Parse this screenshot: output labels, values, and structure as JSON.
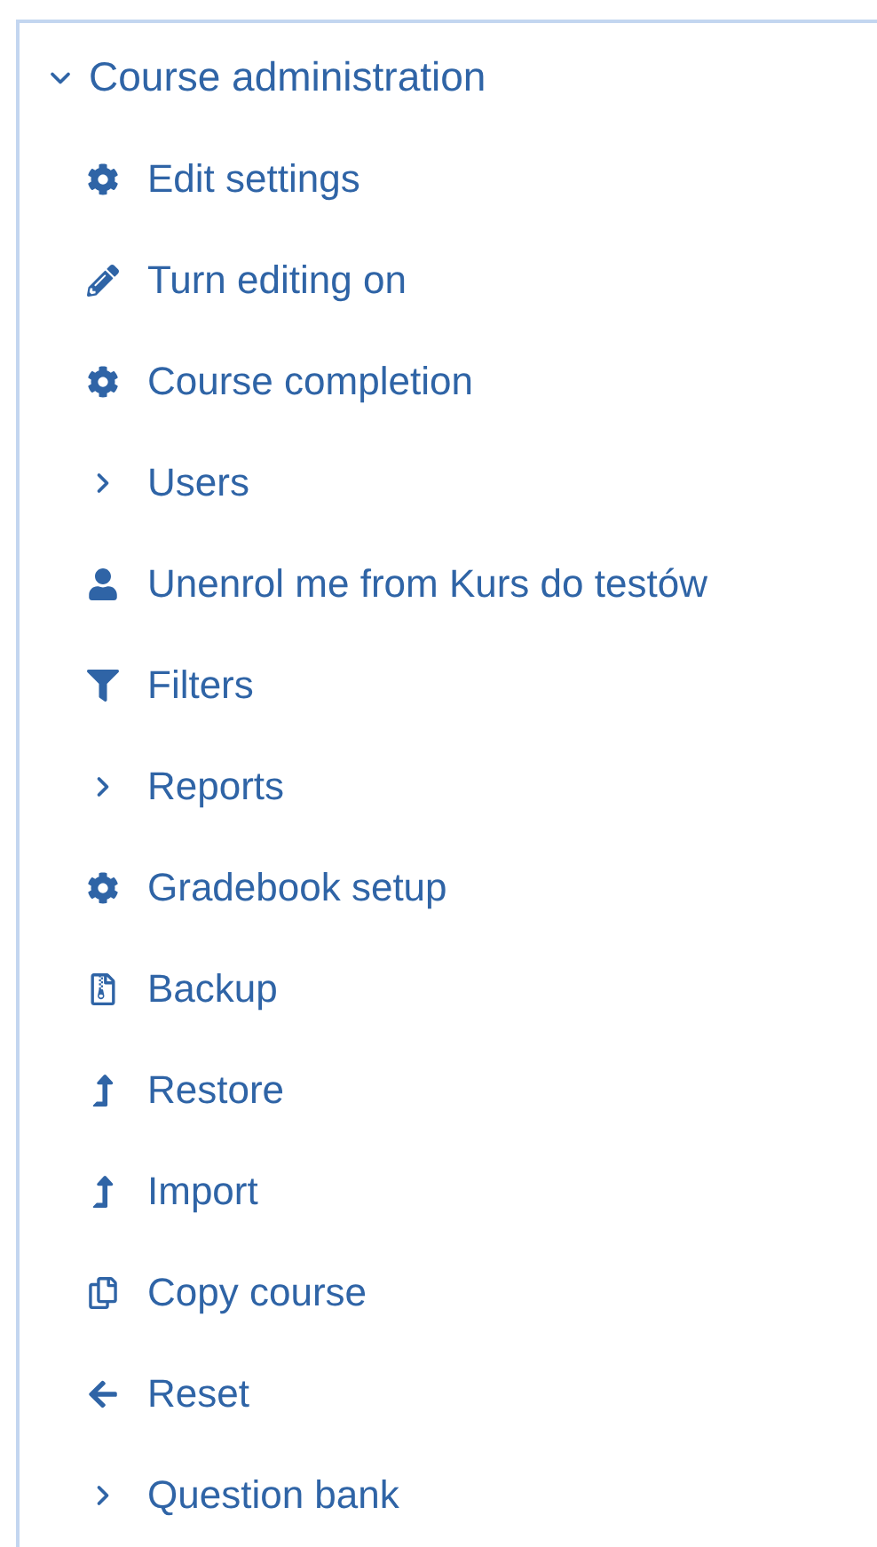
{
  "section": {
    "title": "Course administration",
    "expanded": true
  },
  "items": [
    {
      "label": "Edit settings",
      "kind": "gear"
    },
    {
      "label": "Turn editing on",
      "kind": "pencil"
    },
    {
      "label": "Course completion",
      "kind": "gear"
    },
    {
      "label": "Users",
      "kind": "branch",
      "expanded": false
    },
    {
      "label": "Unenrol me from Kurs do testów",
      "kind": "user"
    },
    {
      "label": "Filters",
      "kind": "filter"
    },
    {
      "label": "Reports",
      "kind": "branch",
      "expanded": false
    },
    {
      "label": "Gradebook setup",
      "kind": "gear"
    },
    {
      "label": "Backup",
      "kind": "backup"
    },
    {
      "label": "Restore",
      "kind": "upload"
    },
    {
      "label": "Import",
      "kind": "upload"
    },
    {
      "label": "Copy course",
      "kind": "copy"
    },
    {
      "label": "Reset",
      "kind": "back"
    },
    {
      "label": "Question bank",
      "kind": "branch",
      "expanded": false
    }
  ]
}
